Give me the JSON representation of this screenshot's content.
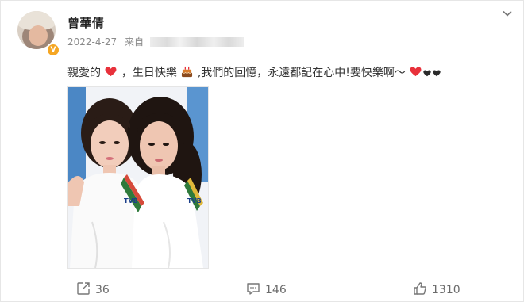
{
  "post": {
    "author": "曾華倩",
    "date": "2022-4-27",
    "source_label": "来自",
    "content": {
      "part1": "親愛的",
      "part2": "，生日快樂",
      "part3": ",我們的回憶，永遠都記在心中!要快樂啊～"
    },
    "photo_text": "TVB"
  },
  "stats": {
    "reposts": "36",
    "comments": "146",
    "likes": "1310"
  },
  "colors": {
    "heart_red": "#e8313b",
    "heart_black": "#2b2b2b",
    "verified_badge": "#f5a623"
  },
  "icons": [
    "chevron-down-icon",
    "heart-icon",
    "cake-icon",
    "repost-icon",
    "comment-icon",
    "like-icon",
    "verified-icon"
  ]
}
